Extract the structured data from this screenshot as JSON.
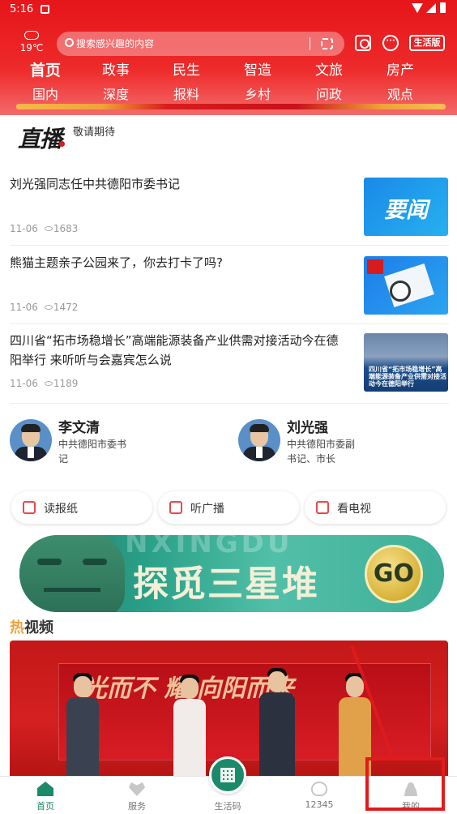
{
  "status_bar": {
    "time": "5:16"
  },
  "header": {
    "weather_temp": "19℃",
    "search_placeholder": "搜索感兴趣的内容",
    "life_version_label": "生活版",
    "nav_row1": [
      "首页",
      "政事",
      "民生",
      "智造",
      "文旅",
      "房产"
    ],
    "nav_row2": [
      "国内",
      "深度",
      "报料",
      "乡村",
      "问政",
      "观点"
    ],
    "active_nav": "首页"
  },
  "live": {
    "logo_text": "直播",
    "status": "敬请期待"
  },
  "news": [
    {
      "title": "刘光强同志任中共德阳市委书记",
      "date": "11-06",
      "views": "1683",
      "thumb_text": "要闻"
    },
    {
      "title": "熊猫主题亲子公园来了，你去打卡了吗?",
      "date": "11-06",
      "views": "1472"
    },
    {
      "title": "四川省“拓市场稳增长”高端能源装备产业供需对接活动今在德阳举行 来听听与会嘉宾怎么说",
      "date": "11-06",
      "views": "1189",
      "thumb_caption": "四川省“拓市场稳增长”高端能源装备产业供需对接活动今在德阳举行"
    }
  ],
  "leaders": [
    {
      "name": "李文清",
      "role": "中共德阳市委书记"
    },
    {
      "name": "刘光强",
      "role": "中共德阳市委副书记、市长"
    }
  ],
  "media_buttons": [
    "读报纸",
    "听广播",
    "看电视"
  ],
  "promo_banner": {
    "title": "探觅三星堆",
    "bg_text": "NXINGDU",
    "cta": "GO"
  },
  "hot_video": {
    "title_hot": "热",
    "title_rest": "视频",
    "stage_text": "光而不 耀 向阳而来"
  },
  "tab_bar": [
    {
      "label": "首页",
      "icon": "home-icon",
      "active": true
    },
    {
      "label": "服务",
      "icon": "service-icon",
      "active": false
    },
    {
      "label": "生活码",
      "icon": "qr-code-icon",
      "active": false
    },
    {
      "label": "12345",
      "icon": "hotline-icon",
      "active": false
    },
    {
      "label": "我的",
      "icon": "profile-icon",
      "active": false
    }
  ],
  "colors": {
    "brand_red": "#e6151a",
    "tab_active": "#1b8a6b",
    "hot_orange": "#f0a33a"
  }
}
